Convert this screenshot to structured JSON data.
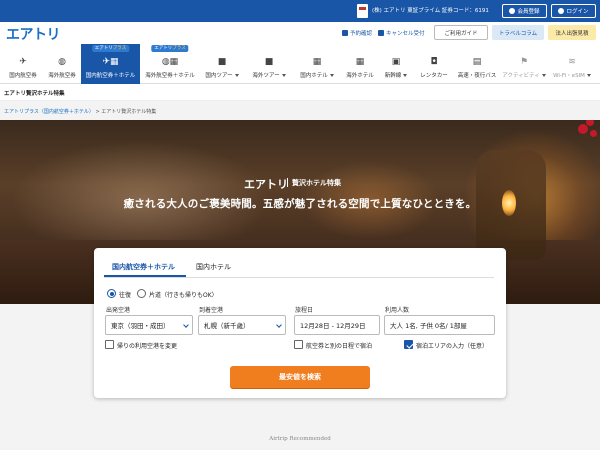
{
  "topbar": {
    "listing": "(株) エアトリ 東証プライム 証券コード：6191",
    "register": "会員登録",
    "login": "ログイン"
  },
  "header": {
    "logo": "エアトリ",
    "util": {
      "reservation": "予約確認",
      "cancel": "キャンセル受付",
      "guide": "ご利用ガイド",
      "column": "トラベルコラム",
      "corporate": "法人出張見積"
    }
  },
  "nav": {
    "items": [
      {
        "label": "国内航空券",
        "icon": "airplane-icon",
        "glyph": "✈"
      },
      {
        "label": "海外航空券",
        "icon": "globe-icon",
        "glyph": "◍"
      },
      {
        "label": "国内航空券＋ホテル",
        "icon": "airplane-hotel-icon",
        "glyph": "✈▦",
        "tag_a": "エアトリ",
        "tag_b": "プラス"
      },
      {
        "label": "海外航空券＋ホテル",
        "icon": "globe-hotel-icon",
        "glyph": "◍▦",
        "tag_a": "エアトリ",
        "tag_b": "プラス"
      },
      {
        "label": "国内ツアー",
        "icon": "suitcase-icon",
        "glyph": "■"
      },
      {
        "label": "海外ツアー",
        "icon": "suitcase-icon",
        "glyph": "■"
      },
      {
        "label": "国内ホテル",
        "icon": "hotel-icon",
        "glyph": "▦"
      },
      {
        "label": "海外ホテル",
        "icon": "hotel-icon",
        "glyph": "▦"
      },
      {
        "label": "新幹線",
        "icon": "train-icon",
        "glyph": "▣"
      },
      {
        "label": "レンタカー",
        "icon": "car-icon",
        "glyph": "◘"
      },
      {
        "label": "高速・夜行バス",
        "icon": "bus-icon",
        "glyph": "▤"
      },
      {
        "label": "アクティビティ",
        "icon": "activity-icon",
        "glyph": "⚑"
      },
      {
        "label": "Wi-Fi・eSIM",
        "icon": "wifi-icon",
        "glyph": "≋"
      }
    ]
  },
  "page": {
    "title": "エアトリ贅沢ホテル特集",
    "breadcrumb_link": "エアトリプラス（国内航空券＋ホテル）",
    "breadcrumb_sep": ">",
    "breadcrumb_current": "エアトリ贅沢ホテル特集"
  },
  "hero": {
    "logo": "エアトリ",
    "subtitle": "贅沢ホテル特集",
    "catch": "癒される大人のご褒美時間。五感が魅了される空間で上質なひとときを。"
  },
  "search": {
    "tab_active": "国内航空券＋ホテル",
    "tab_inactive": "国内ホテル",
    "radio_round": "往復",
    "radio_oneway": "片道（行きも帰りもOK）",
    "departure_label": "出発空港",
    "departure_value": "東京（羽田・成田）",
    "arrival_label": "到着空港",
    "arrival_value": "札幌（新千歳）",
    "date_label": "旅程日",
    "date_value": "12月28日 - 12月29日",
    "people_label": "利用人数",
    "people_value": "大人 1名, 子供 0名/ 1部屋",
    "check_return": "帰りの利用空港を変更",
    "check_separate": "航空券と別の日程で宿泊",
    "check_area": "宿泊エリアの入力（任意）",
    "submit": "最安値を検索"
  },
  "footer": {
    "recommended": "Airtrip Recommended"
  },
  "colors": {
    "brand_blue": "#1a56a8",
    "accent_orange": "#f07d1e"
  }
}
